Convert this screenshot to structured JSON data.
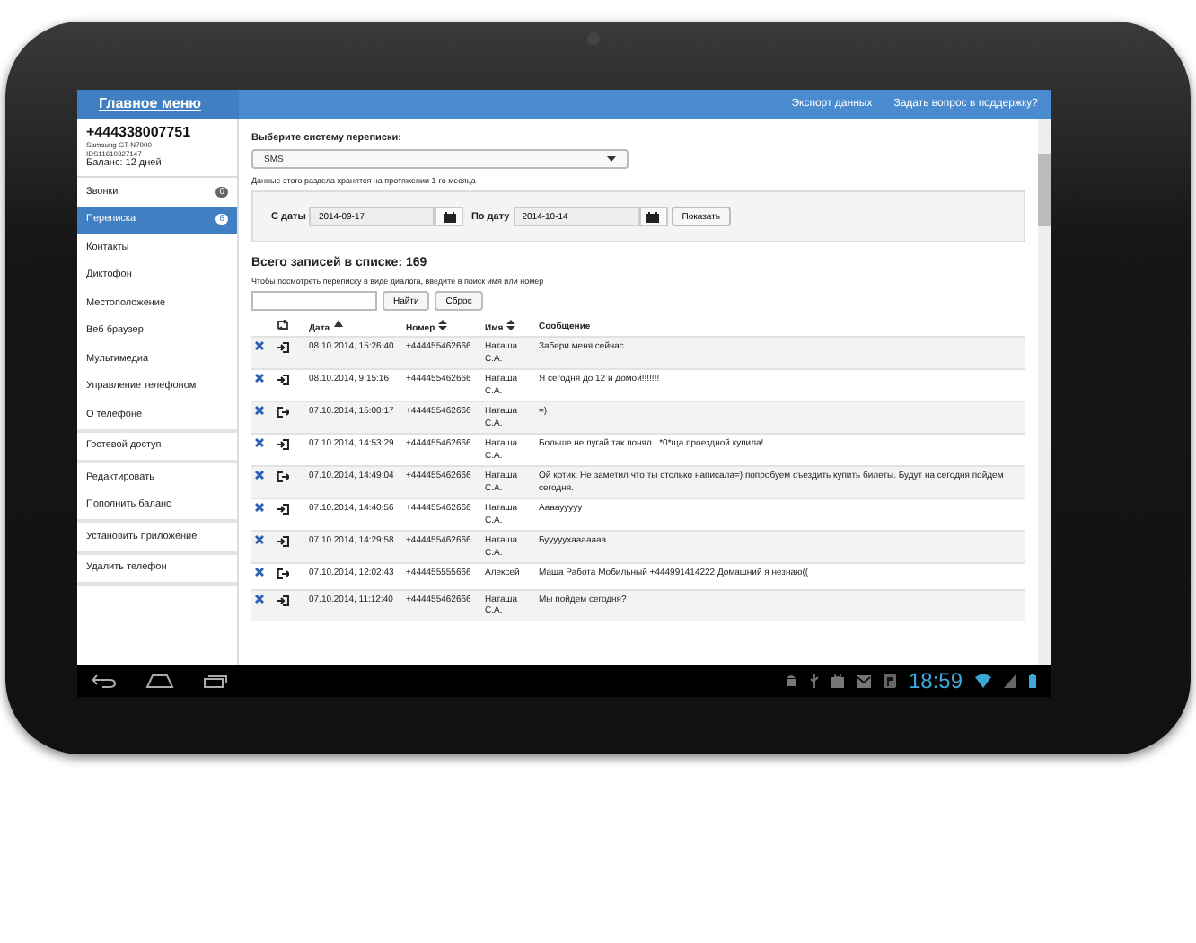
{
  "topbar": {
    "title": "Главное меню",
    "links": [
      "Экспорт данных",
      "Задать вопрос в поддержку?"
    ]
  },
  "device": {
    "phone": "+444338007751",
    "model": "Samsung GT-N7000",
    "serial": "IDS11610327147",
    "balance": "Баланс: 12 дней"
  },
  "sidebar": {
    "groups": [
      [
        {
          "label": "Звонки",
          "badge": "0",
          "selected": false
        },
        {
          "label": "Переписка",
          "badge": "6",
          "selected": true
        },
        {
          "label": "Контакты",
          "selected": false
        },
        {
          "label": "Диктофон",
          "selected": false
        },
        {
          "label": "Местоположение",
          "selected": false
        },
        {
          "label": "Веб браузер",
          "selected": false
        },
        {
          "label": "Мультимедиа",
          "selected": false
        },
        {
          "label": "Управление телефоном",
          "selected": false
        },
        {
          "label": "О телефоне",
          "selected": false
        }
      ],
      [
        {
          "label": "Гостевой доступ",
          "selected": false
        }
      ],
      [
        {
          "label": "Редактировать",
          "selected": false
        },
        {
          "label": "Пополнить баланс",
          "selected": false
        }
      ],
      [
        {
          "label": "Установить приложение",
          "selected": false
        }
      ],
      [
        {
          "label": "Удалить телефон",
          "selected": false
        }
      ]
    ]
  },
  "filter": {
    "system_label": "Выберите систему переписки:",
    "system_value": "SMS",
    "note": "Данные этого раздела хранятся на протяжении 1-го месяца",
    "from_label": "С даты",
    "from_value": "2014-09-17",
    "to_label": "По дату",
    "to_value": "2014-10-14",
    "show_button": "Показать"
  },
  "summary": {
    "heading": "Всего записей в списке: 169",
    "hint": "Чтобы посмотреть переписку в виде диалога, введите в поиск имя или номер",
    "find_button": "Найти",
    "reset_button": "Сброс"
  },
  "table": {
    "columns": [
      {
        "label": "Дата",
        "kind": "sorted"
      },
      {
        "label": "Номер",
        "kind": "sortable"
      },
      {
        "label": "Имя",
        "kind": "sortable"
      },
      {
        "label": "Сообщение",
        "kind": "plain"
      }
    ],
    "rows": [
      {
        "kind": "incoming",
        "date": "08.10.2014, 15:26:40",
        "number": "+444455462666",
        "name": "Наташа С.А.",
        "message": "Забери меня сейчас"
      },
      {
        "kind": "incoming",
        "date": "08.10.2014, 9:15:16",
        "number": "+444455462666",
        "name": "Наташа С.А.",
        "message": "Я сегодня до 12 и домой!!!!!!!"
      },
      {
        "kind": "outgoing",
        "date": "07.10.2014, 15:00:17",
        "number": "+444455462666",
        "name": "Наташа С.А.",
        "message": "=)"
      },
      {
        "kind": "incoming",
        "date": "07.10.2014, 14:53:29",
        "number": "+444455462666",
        "name": "Наташа С.А.",
        "message": "Больше не пугай так понял...*0*ща проездной купила!"
      },
      {
        "kind": "outgoing",
        "date": "07.10.2014, 14:49:04",
        "number": "+444455462666",
        "name": "Наташа С.А.",
        "message": "Ой котик. Не заметил что ты столько написала=) попробуем съездить купить билеты. Будут на сегодня пойдем сегодня."
      },
      {
        "kind": "incoming",
        "date": "07.10.2014, 14:40:56",
        "number": "+444455462666",
        "name": "Наташа С.А.",
        "message": "Ааааууууу"
      },
      {
        "kind": "incoming",
        "date": "07.10.2014, 14:29:58",
        "number": "+444455462666",
        "name": "Наташа С.А.",
        "message": "Бууууухааааааа"
      },
      {
        "kind": "outgoing",
        "date": "07.10.2014, 12:02:43",
        "number": "+444455555666",
        "name": "Алексей",
        "message": "Маша Работа Мобильный +444991414222 Домашний я незнаю(("
      },
      {
        "kind": "incoming",
        "date": "07.10.2014, 11:12:40",
        "number": "+444455462666",
        "name": "Наташа С.А.",
        "message": "Мы пойдем сегодня?"
      }
    ]
  },
  "statusbar": {
    "time": "18:59"
  }
}
